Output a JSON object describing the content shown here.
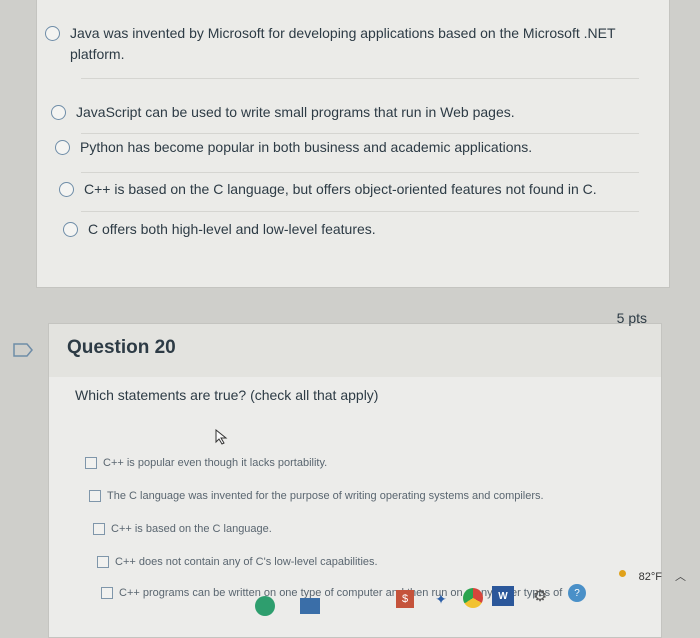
{
  "question19": {
    "options": [
      "Java was invented by Microsoft for developing applications based on the Microsoft .NET platform.",
      "JavaScript can be used to write small programs that run in Web pages.",
      "Python has become popular in both business and academic applications.",
      "C++ is based on the C language, but offers object-oriented features not found in C.",
      "C offers both high-level and low-level features."
    ]
  },
  "question20": {
    "title": "Question 20",
    "points": "5 pts",
    "prompt": "Which statements are true? (check all that apply)",
    "options": [
      "C++ is popular even though it lacks portability.",
      "The C language was invented for the purpose of writing operating systems and compilers.",
      "C++ is based on the C language.",
      "C++ does not contain any of C's low-level capabilities.",
      "C++ programs can be written on one type of computer and then run on many other types of"
    ]
  },
  "taskbar": {
    "temperature": "82°F",
    "icons": [
      "edge-icon",
      "app-icon",
      "store-icon",
      "dropbox-icon",
      "chrome-icon",
      "word-icon",
      "settings-icon",
      "help-icon"
    ]
  },
  "colors": {
    "accent": "#2d3b45",
    "radio": "#6f8da8"
  }
}
